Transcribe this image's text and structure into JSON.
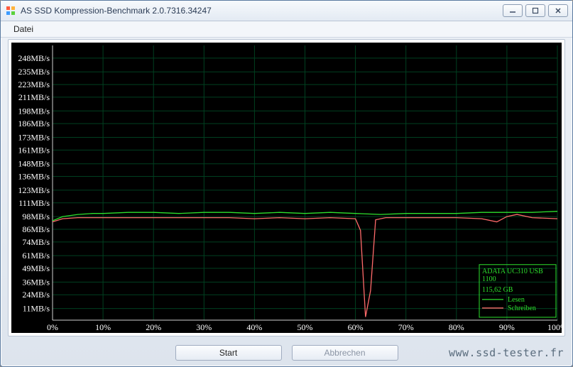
{
  "window": {
    "title": "AS SSD Kompression-Benchmark 2.0.7316.34247"
  },
  "menu": {
    "file": "Datei"
  },
  "buttons": {
    "start": "Start",
    "abort": "Abbrechen"
  },
  "info": {
    "device": "ADATA UC310 USB",
    "firmware": "1100",
    "capacity": "115,62 GB"
  },
  "legend": {
    "read": "Lesen",
    "write": "Schreiben"
  },
  "colors": {
    "read": "#2de02d",
    "write": "#ff6a6a",
    "grid": "#004020",
    "axis": "#d0d0d0",
    "info": "#2de02d"
  },
  "watermark": "www.ssd-tester.fr",
  "chart_data": {
    "type": "line",
    "title": "",
    "xlabel": "",
    "ylabel": "",
    "x_unit": "%",
    "y_unit": "MB/s",
    "xlim": [
      0,
      100
    ],
    "ylim": [
      0,
      260
    ],
    "y_ticks": [
      11,
      24,
      36,
      49,
      61,
      74,
      86,
      98,
      111,
      123,
      136,
      148,
      161,
      173,
      186,
      198,
      211,
      223,
      235,
      248
    ],
    "y_tick_labels": [
      "11MB/s",
      "24MB/s",
      "36MB/s",
      "49MB/s",
      "61MB/s",
      "74MB/s",
      "86MB/s",
      "98MB/s",
      "111MB/s",
      "123MB/s",
      "136MB/s",
      "148MB/s",
      "161MB/s",
      "173MB/s",
      "186MB/s",
      "198MB/s",
      "211MB/s",
      "223MB/s",
      "235MB/s",
      "248MB/s"
    ],
    "x_ticks": [
      0,
      10,
      20,
      30,
      40,
      50,
      60,
      70,
      80,
      90,
      100
    ],
    "x_tick_labels": [
      "0%",
      "10%",
      "20%",
      "30%",
      "40%",
      "50%",
      "60%",
      "70%",
      "80%",
      "90%",
      "100%"
    ],
    "series": [
      {
        "name": "Lesen",
        "color": "#2de02d",
        "x": [
          0,
          2,
          5,
          8,
          10,
          15,
          20,
          25,
          30,
          35,
          40,
          45,
          50,
          55,
          60,
          65,
          70,
          75,
          80,
          85,
          90,
          95,
          100
        ],
        "y": [
          94,
          98,
          100,
          101,
          101,
          102,
          102,
          101,
          102,
          102,
          101,
          102,
          101,
          102,
          101,
          100,
          101,
          101,
          101,
          102,
          102,
          102,
          103
        ]
      },
      {
        "name": "Schreiben",
        "color": "#ff6a6a",
        "x": [
          0,
          2,
          5,
          8,
          10,
          15,
          20,
          25,
          30,
          35,
          40,
          45,
          50,
          55,
          60,
          61,
          62,
          63,
          64,
          65,
          66,
          70,
          75,
          80,
          85,
          88,
          90,
          92,
          95,
          100
        ],
        "y": [
          93,
          96,
          97,
          97,
          97,
          97,
          97,
          97,
          97,
          97,
          96,
          97,
          96,
          97,
          96,
          85,
          3,
          28,
          95,
          96,
          97,
          97,
          97,
          97,
          96,
          93,
          98,
          100,
          97,
          96
        ]
      }
    ]
  }
}
